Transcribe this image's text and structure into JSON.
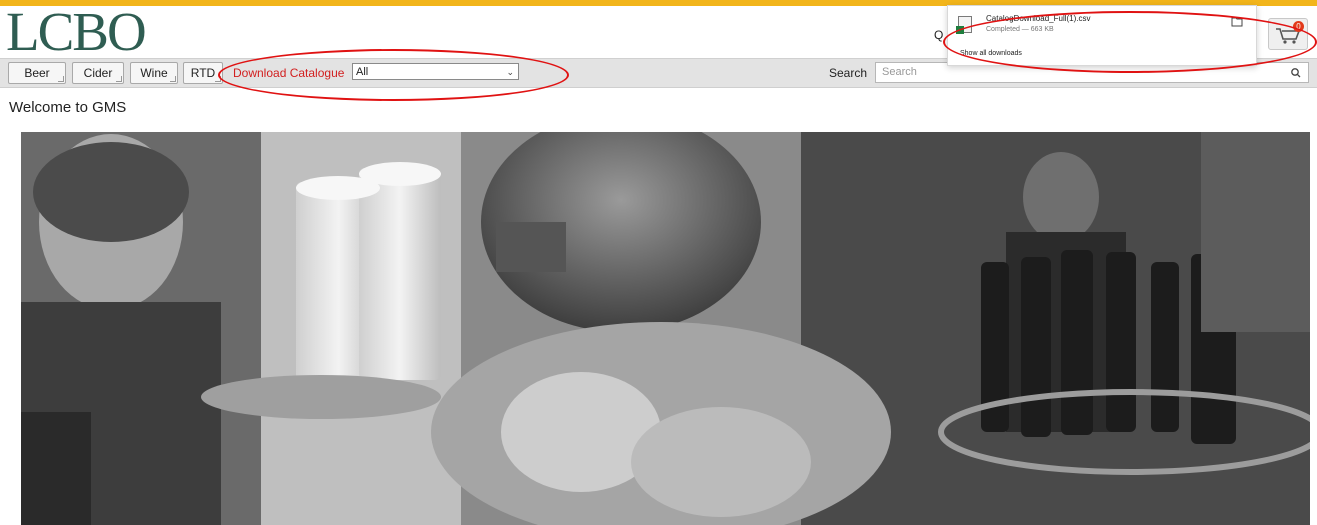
{
  "header": {
    "logo": "LCBO",
    "nav_buttons": [
      "Beer",
      "Cider",
      "Wine",
      "RTD"
    ],
    "download_catalogue_label": "Download Catalogue",
    "catalogue_select_value": "All",
    "search_label": "Search",
    "search_placeholder": "Search",
    "partial_text": "Q",
    "cart_badge": "0"
  },
  "downloads_panel": {
    "file_name": "CatalogDownload_Full(1).csv",
    "status": "Completed — 663 KB",
    "show_all": "Show all downloads"
  },
  "main": {
    "welcome": "Welcome to GMS"
  },
  "colors": {
    "accent_bar": "#f2b51b",
    "logo": "#2f5d52",
    "download_label": "#d21f1f",
    "annotation": "#e01212"
  }
}
